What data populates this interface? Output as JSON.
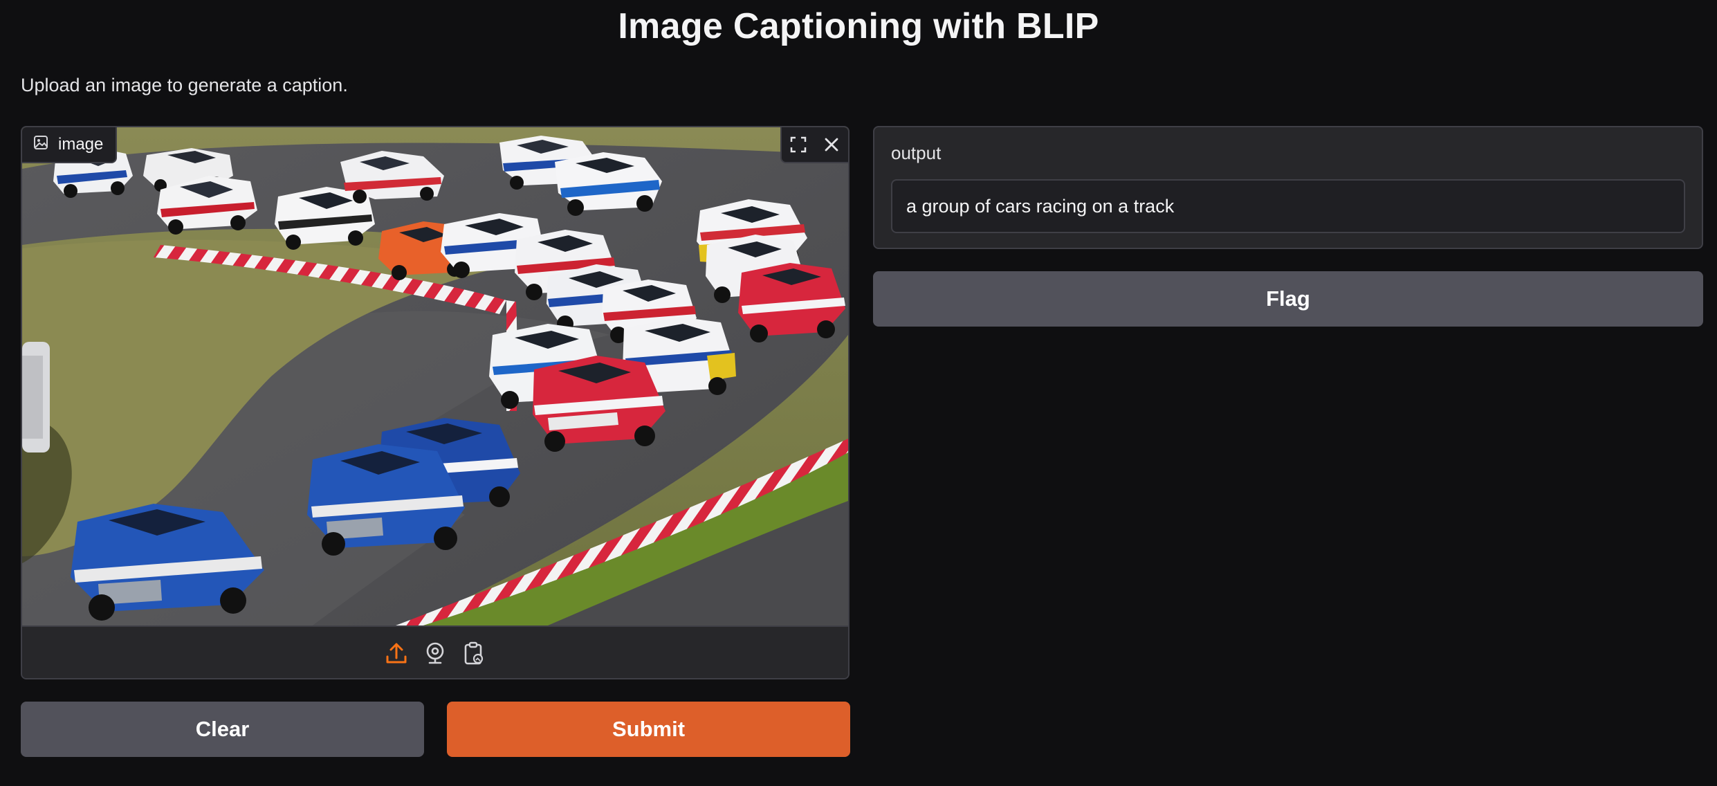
{
  "page": {
    "title": "Image Captioning with BLIP",
    "description": "Upload an image to generate a caption."
  },
  "image_input": {
    "label": "image",
    "label_icon": "image-icon",
    "controls": [
      "fullscreen-icon",
      "close-icon"
    ],
    "sources": [
      {
        "name": "upload-icon",
        "active": true,
        "color": "#f97316"
      },
      {
        "name": "webcam-icon",
        "active": false
      },
      {
        "name": "clipboard-icon",
        "active": false
      }
    ],
    "image_subject": "touring cars racing on a track"
  },
  "buttons": {
    "clear": "Clear",
    "submit": "Submit",
    "flag": "Flag"
  },
  "output": {
    "label": "output",
    "value": "a group of cars racing on a track"
  },
  "colors": {
    "background": "#0f0f11",
    "panel": "#27272a",
    "border": "#3f3f46",
    "primary": "#dd5f2a",
    "secondary": "#52525b"
  }
}
